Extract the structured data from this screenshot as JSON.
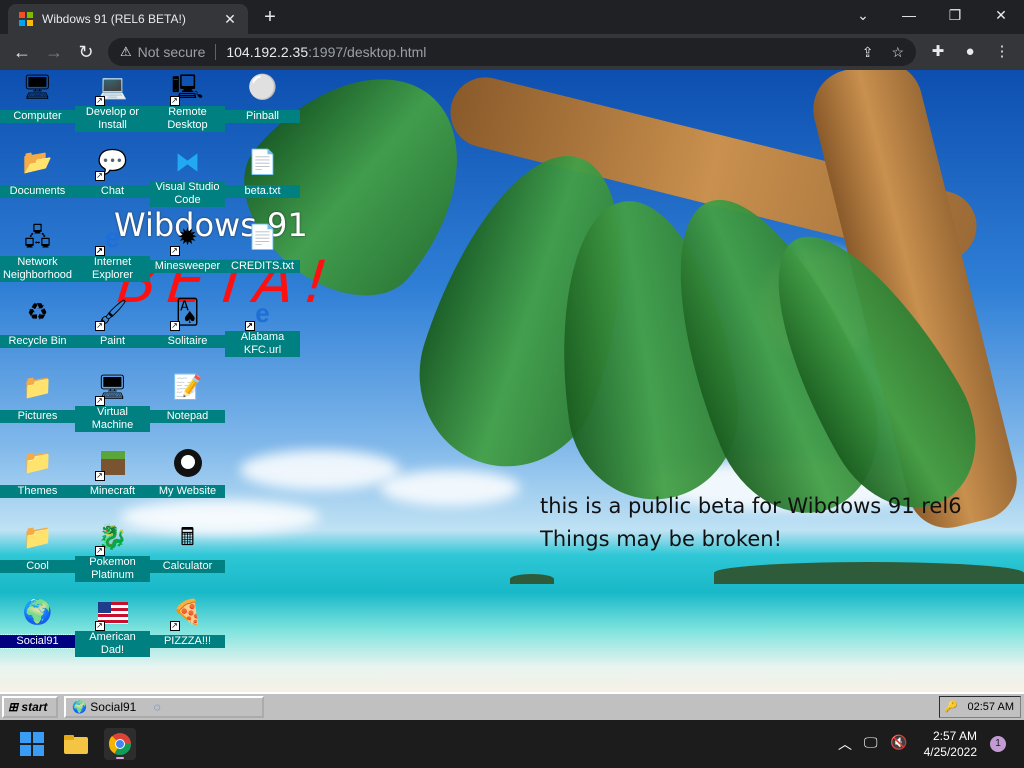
{
  "browser": {
    "tab_title": "Wibdows 91 (REL6 BETA!)",
    "security_label": "Not secure",
    "url_host": "104.192.2.35",
    "url_path": ":1997/desktop.html"
  },
  "desktop": {
    "watermark_title": "Wibdows 91",
    "watermark_beta": "BETA!",
    "notice_line1": "this is a public beta for Wibdows 91 rel6",
    "notice_line2": "Things may be broken!",
    "icons": [
      {
        "label": "Computer",
        "icon": "computer-icon"
      },
      {
        "label": "Develop or Install",
        "icon": "develop-icon"
      },
      {
        "label": "Remote Desktop",
        "icon": "remote-desktop-icon"
      },
      {
        "label": "Pinball",
        "icon": "pinball-icon"
      },
      {
        "label": "Documents",
        "icon": "folder-icon"
      },
      {
        "label": "Chat",
        "icon": "chat-icon"
      },
      {
        "label": "Visual Studio Code",
        "icon": "vscode-icon"
      },
      {
        "label": "beta.txt",
        "icon": "text-file-icon"
      },
      {
        "label": "Network Neighborhood",
        "icon": "network-icon"
      },
      {
        "label": "Internet Explorer",
        "icon": "ie-icon"
      },
      {
        "label": "Minesweeper",
        "icon": "minesweeper-icon"
      },
      {
        "label": "CREDITS.txt",
        "icon": "text-file-icon"
      },
      {
        "label": "Recycle Bin",
        "icon": "recycle-bin-icon"
      },
      {
        "label": "Paint",
        "icon": "paint-icon"
      },
      {
        "label": "Solitaire",
        "icon": "solitaire-icon"
      },
      {
        "label": "Alabama KFC.url",
        "icon": "url-icon"
      },
      {
        "label": "Pictures",
        "icon": "folder-icon"
      },
      {
        "label": "Virtual Machine",
        "icon": "vm-icon"
      },
      {
        "label": "Notepad",
        "icon": "notepad-icon"
      },
      {
        "label": "Themes",
        "icon": "folder-icon"
      },
      {
        "label": "Minecraft",
        "icon": "minecraft-icon"
      },
      {
        "label": "My Website",
        "icon": "github-icon"
      },
      {
        "label": "Cool",
        "icon": "folder-icon"
      },
      {
        "label": "Pokemon Platinum",
        "icon": "pokemon-icon"
      },
      {
        "label": "Calculator",
        "icon": "calculator-icon"
      },
      {
        "label": "Social91",
        "icon": "globe-icon"
      },
      {
        "label": "American Dad!",
        "icon": "flag-icon"
      },
      {
        "label": "PIZZZA!!!",
        "icon": "pizza-icon"
      }
    ]
  },
  "taskbar91": {
    "start_label": "start",
    "task_label": "Social91",
    "tray_time": "02:57 AM"
  },
  "win11": {
    "time": "2:57 AM",
    "date": "4/25/2022",
    "notification_count": "1"
  }
}
